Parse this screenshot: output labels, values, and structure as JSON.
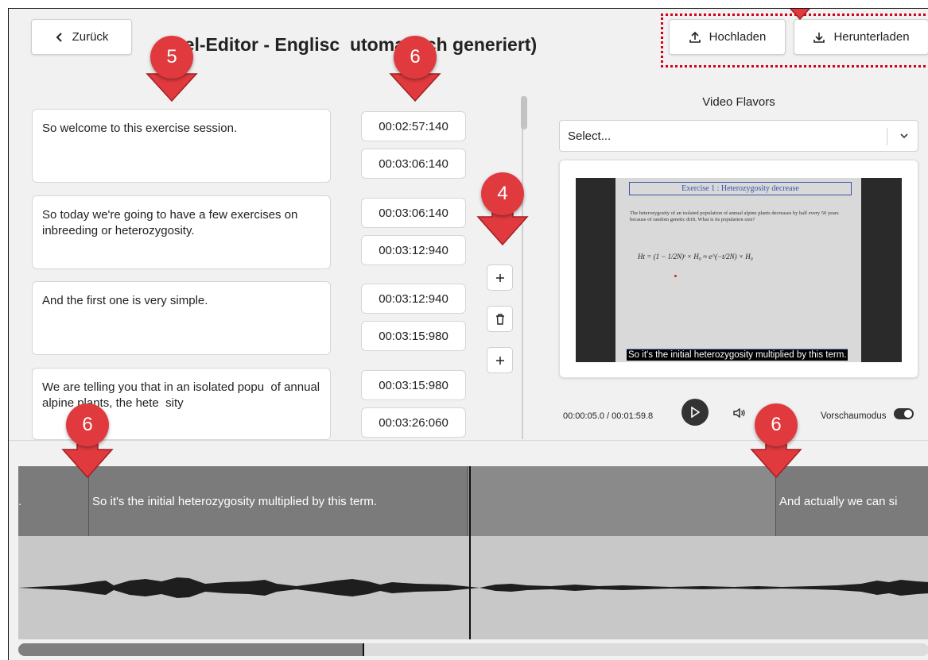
{
  "header": {
    "back_label": "Zurück",
    "title": "rtitel-Editor - Englisc  utomatisch generiert)",
    "upload_label": "Hochladen",
    "download_label": "Herunterladen"
  },
  "segments": [
    {
      "text": "So welcome to this exercise session.",
      "start": "00:02:57:140",
      "end": "00:03:06:140"
    },
    {
      "text": "So today we're going to have a few exercises on inbreeding or heterozygosity.",
      "start": "00:03:06:140",
      "end": "00:03:12:940"
    },
    {
      "text": "And the first one is very simple.",
      "start": "00:03:12:940",
      "end": "00:03:15:980"
    },
    {
      "text": "We are telling you that in an isolated popu  of annual alpine plants, the hete  sity",
      "start": "00:03:15:980",
      "end": "00:03:26:060"
    }
  ],
  "tools": {
    "add_icon": "plus-icon",
    "delete_icon": "trash-icon"
  },
  "video_panel": {
    "flavors_label": "Video Flavors",
    "select_value": "Select...",
    "slide_title": "Exercise 1 : Heterozygosity decrease",
    "slide_text": "The heterozygosity of an isolated population of annual alpine plants decreases by half every 50 years because of random genetic drift. What is its population size?",
    "slide_formula": "Ht = (1 − 1/2N)ᵗ × H₀ ≈ e^(−t/2N) × H₀",
    "subtitle_overlay": "So it's the initial heterozygosity multiplied by this term."
  },
  "player": {
    "time": "00:00:05.0 / 00:01:59.8",
    "preview_label": "Vorschaumodus",
    "preview_on": true
  },
  "timeline": {
    "segments": [
      {
        "text": "."
      },
      {
        "text": "So it's the initial heterozygosity multiplied by this term."
      },
      {
        "text": ""
      },
      {
        "text": "And actually we can si"
      }
    ],
    "scroll_fraction": 0.38
  },
  "annotations": {
    "markers": [
      "5",
      "6",
      "4",
      "6",
      "6"
    ]
  },
  "colors": {
    "marker": "#e03a3e",
    "highlight_box": "#d0021b"
  }
}
